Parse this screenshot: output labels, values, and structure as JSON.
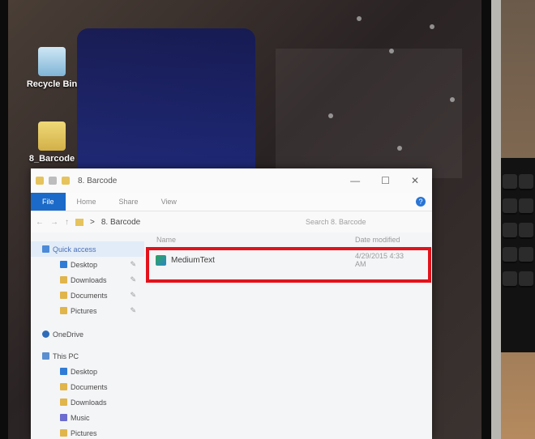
{
  "desktop": {
    "icons": [
      {
        "label": "Recycle Bin",
        "icon": "recycle-bin-icon"
      },
      {
        "label": "8_Barcode",
        "icon": "folder-icon"
      }
    ]
  },
  "window": {
    "title": "8. Barcode",
    "controls": {
      "minimize": "—",
      "maximize": "☐",
      "close": "✕"
    },
    "ribbon_tabs": [
      "File",
      "Home",
      "Share",
      "View"
    ],
    "help": "?"
  },
  "address": {
    "back": "←",
    "forward": "→",
    "up": "↑",
    "separator": ">",
    "path": "8. Barcode",
    "search_placeholder": "Search 8. Barcode"
  },
  "nav": {
    "quick_access": "Quick access",
    "quick_items": [
      "Desktop",
      "Downloads",
      "Documents",
      "Pictures"
    ],
    "onedrive": "OneDrive",
    "this_pc": "This PC",
    "pc_items": [
      "Desktop",
      "Documents",
      "Downloads",
      "Music",
      "Pictures"
    ]
  },
  "content": {
    "columns": {
      "name": "Name",
      "date": "Date modified"
    },
    "files": [
      {
        "name": "MediumText",
        "date": "4/29/2015 4:33 AM"
      }
    ]
  },
  "colors": {
    "highlight": "#e3121b",
    "file_tab": "#1b6ac9"
  }
}
